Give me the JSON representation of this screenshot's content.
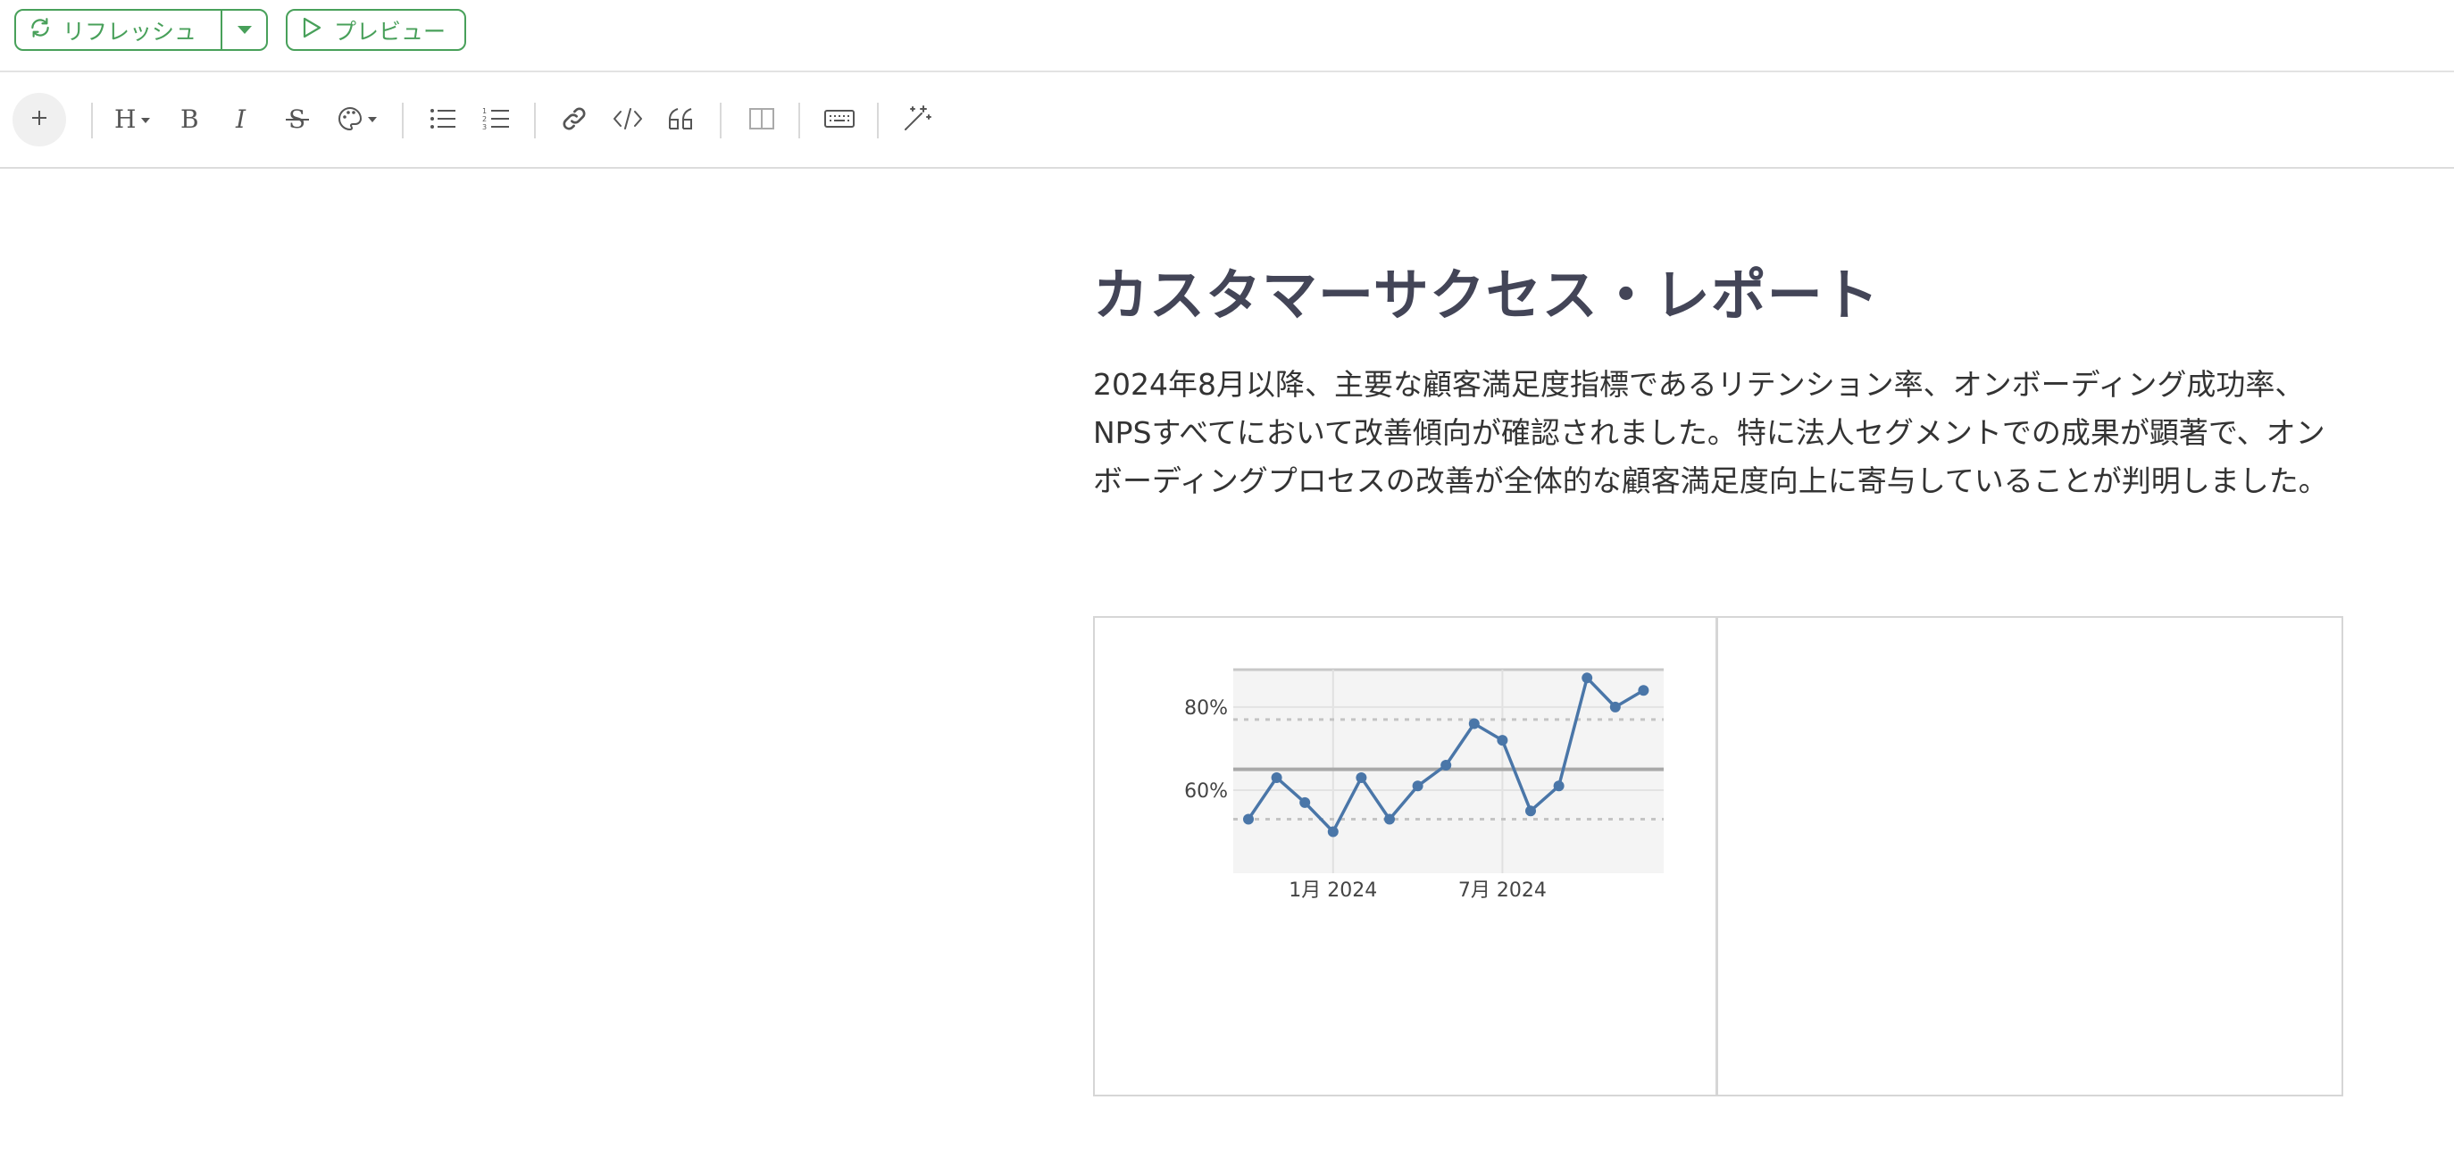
{
  "topbar": {
    "refresh_label": "リフレッシュ",
    "preview_label": "プレビュー",
    "accent_color": "#48a05a"
  },
  "toolbar": {
    "icons": [
      "plus-icon",
      "heading-icon",
      "bold-icon",
      "italic-icon",
      "strikethrough-icon",
      "palette-icon",
      "bullet-list-icon",
      "numbered-list-icon",
      "link-icon",
      "code-icon",
      "quote-icon",
      "columns-icon",
      "keyboard-icon",
      "magic-wand-icon"
    ]
  },
  "document": {
    "title": "カスタマーサクセス・レポート",
    "paragraph": "2024年8月以降、主要な顧客満足度指標であるリテンション率、オンボーディング成功率、NPSすべてにおいて改善傾向が確認されました。特に法人セグメントでの成果が顕著で、オンボーディングプロセスの改善が全体的な顧客満足度向上に寄与していることが判明しました。"
  },
  "chart_data": {
    "type": "line",
    "x": [
      "2023-10",
      "2023-11",
      "2023-12",
      "2024-01",
      "2024-02",
      "2024-03",
      "2024-04",
      "2024-05",
      "2024-06",
      "2024-07",
      "2024-08",
      "2024-09",
      "2024-10",
      "2024-11",
      "2024-12",
      "2025-01"
    ],
    "values": [
      53,
      63,
      57,
      50,
      63,
      53,
      61,
      66,
      76,
      72,
      55,
      61,
      87,
      80,
      84
    ],
    "x_ticks": [
      "1月 2024",
      "7月 2024"
    ],
    "y_ticks": [
      "60%",
      "80%"
    ],
    "mean_line": 65,
    "band_lines": [
      53,
      77
    ],
    "ylim": [
      40,
      89
    ],
    "line_color": "#4a76a8",
    "background": "#f4f4f4",
    "grid": true
  }
}
